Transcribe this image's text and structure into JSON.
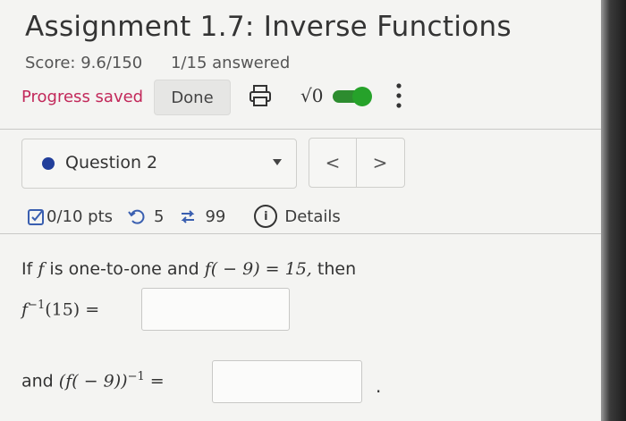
{
  "header": {
    "title": "Assignment 1.7: Inverse Functions",
    "score": "Score: 9.6/150",
    "answered": "1/15 answered",
    "progress_status": "Progress saved",
    "done_label": "Done",
    "sqrt_label": "√0"
  },
  "question_nav": {
    "selected_question": "Question 2",
    "prev_label": "<",
    "next_label": ">"
  },
  "question_meta": {
    "points": "0/10 pts",
    "retries": "5",
    "submissions": "99",
    "details_label": "Details"
  },
  "question": {
    "intro_plain1": "If ",
    "intro_f1": "f",
    "intro_plain2": " is one-to-one and ",
    "intro_math": "f( − 9) = 15,",
    "intro_plain3": " then",
    "expr1": "f",
    "expr1_sup": "−1",
    "expr1_rest": "(15) =",
    "expr2_and": "and ",
    "expr2_math": "(f( − 9))",
    "expr2_sup": "−1",
    "expr2_eq": " =",
    "period": "."
  },
  "colors": {
    "progress_saved": "#c2285a",
    "toggle_on": "#26a22a",
    "question_dot": "#213e9a"
  },
  "icons": [
    "printer-icon",
    "more-vertical-icon",
    "checkbox-edit-icon",
    "retry-icon",
    "submissions-icon",
    "info-icon",
    "chevron-down-icon"
  ]
}
